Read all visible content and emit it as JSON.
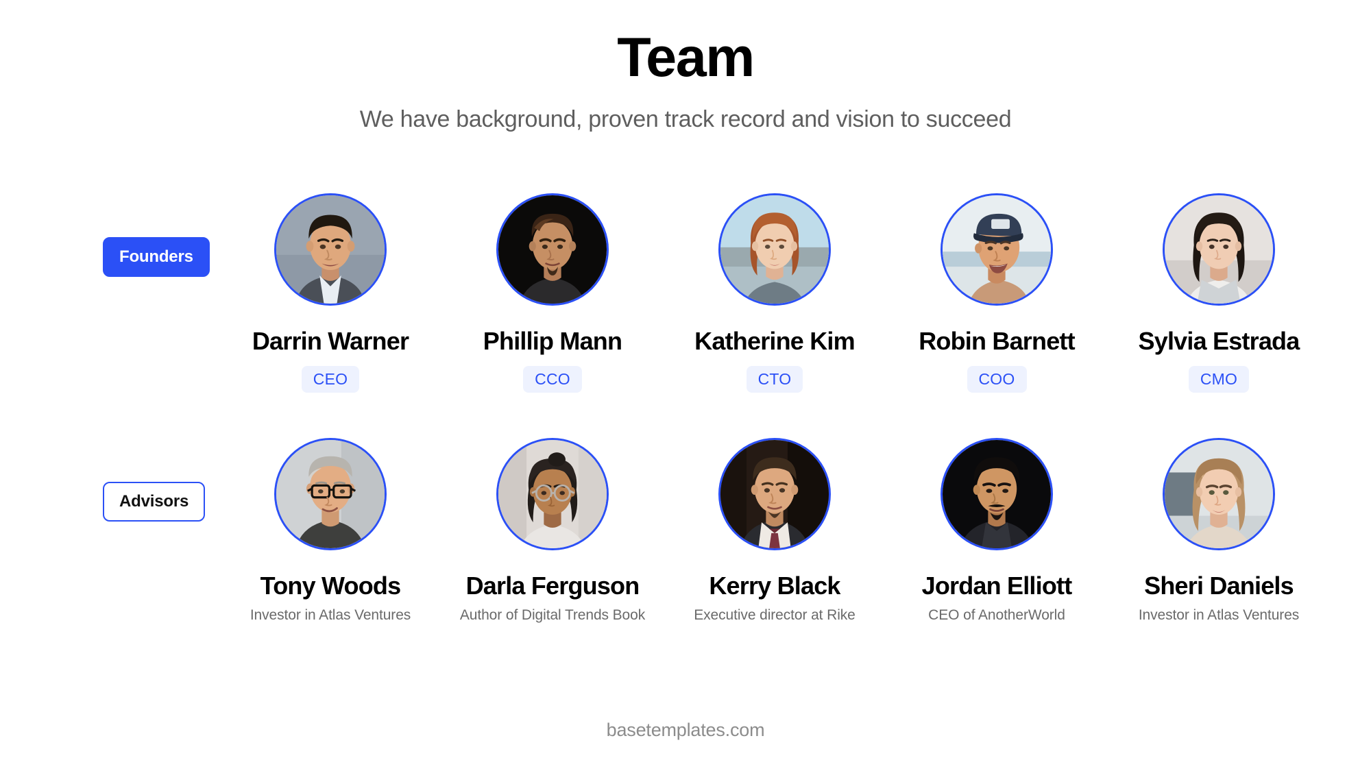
{
  "header": {
    "title": "Team",
    "subtitle": "We have background, proven track record and vision to succeed"
  },
  "colors": {
    "accent": "#2B50F6",
    "pill_bg": "#EEF2FE",
    "title": "#000000",
    "subtitle": "#5e5e5e",
    "muted": "#6a6a6a",
    "footer": "#8c8c8c",
    "background": "#ffffff"
  },
  "sections": [
    {
      "badge": "Founders",
      "badge_style": "filled",
      "people": [
        {
          "name": "Darrin Warner",
          "role": "CEO",
          "avatar": "avatar-darrin-warner"
        },
        {
          "name": "Phillip Mann",
          "role": "CCO",
          "avatar": "avatar-phillip-mann"
        },
        {
          "name": "Katherine Kim",
          "role": "CTO",
          "avatar": "avatar-katherine-kim"
        },
        {
          "name": "Robin Barnett",
          "role": "COO",
          "avatar": "avatar-robin-barnett"
        },
        {
          "name": "Sylvia Estrada",
          "role": "CMO",
          "avatar": "avatar-sylvia-estrada"
        }
      ]
    },
    {
      "badge": "Advisors",
      "badge_style": "outline",
      "people": [
        {
          "name": "Tony Woods",
          "desc": "Investor in Atlas Ventures",
          "avatar": "avatar-tony-woods"
        },
        {
          "name": "Darla Ferguson",
          "desc": "Author of Digital Trends Book",
          "avatar": "avatar-darla-ferguson"
        },
        {
          "name": "Kerry Black",
          "desc": "Executive director at Rike",
          "avatar": "avatar-kerry-black"
        },
        {
          "name": "Jordan Elliott",
          "desc": "CEO of AnotherWorld",
          "avatar": "avatar-jordan-elliott"
        },
        {
          "name": "Sheri Daniels",
          "desc": "Investor in Atlas Ventures",
          "avatar": "avatar-sheri-daniels"
        }
      ]
    }
  ],
  "footer": {
    "text": "basetemplates.com"
  }
}
